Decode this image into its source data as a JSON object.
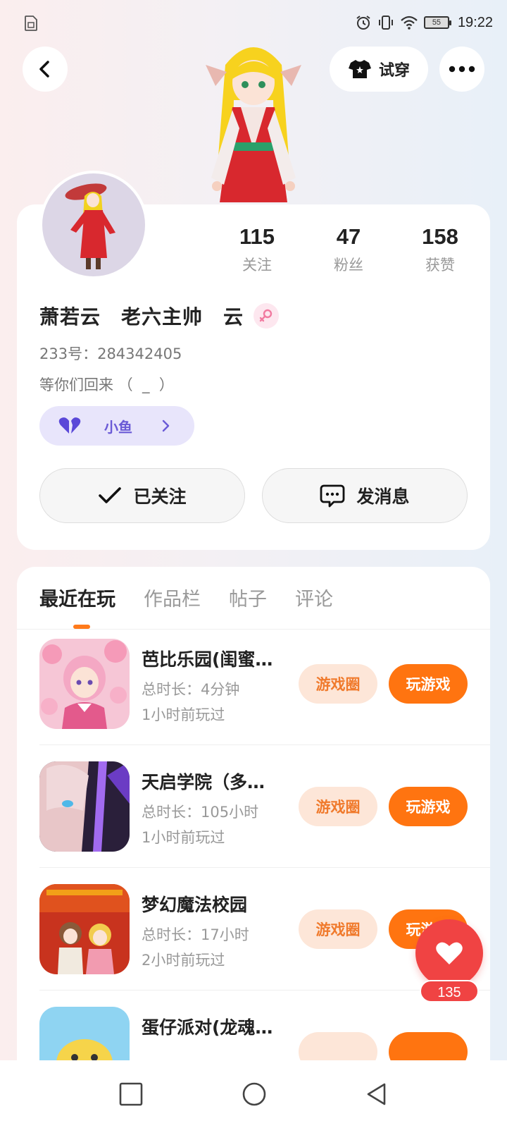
{
  "status_bar": {
    "time": "19:22",
    "battery": "55",
    "icons": [
      "sim-card-icon",
      "alarm-icon",
      "vibrate-icon",
      "wifi-icon",
      "battery-icon"
    ]
  },
  "header": {
    "tryon_label": "试穿",
    "back_icon": "chevron-left-icon",
    "more_icon": "more-dots-icon"
  },
  "profile": {
    "stats": [
      {
        "value": "115",
        "label": "关注"
      },
      {
        "value": "47",
        "label": "粉丝"
      },
      {
        "value": "158",
        "label": "获赞"
      }
    ],
    "name": "萧若云　老六主帅　云",
    "uid": "233号：284342405",
    "bio": "等你们回来 （  _  ）",
    "pet_tag": "小鱼",
    "follow_label": "已关注",
    "message_label": "发消息"
  },
  "tabs": [
    {
      "label": "最近在玩",
      "active": true
    },
    {
      "label": "作品栏",
      "active": false
    },
    {
      "label": "帖子",
      "active": false
    },
    {
      "label": "评论",
      "active": false
    }
  ],
  "games": [
    {
      "title": "芭比乐园(闺蜜…",
      "duration": "总时长：4分钟",
      "last_played": "1小时前玩过",
      "circle_label": "游戏圈",
      "play_label": "玩游戏"
    },
    {
      "title": "天启学院（多…",
      "duration": "总时长：105小时",
      "last_played": "1小时前玩过",
      "circle_label": "游戏圈",
      "play_label": "玩游戏"
    },
    {
      "title": "梦幻魔法校园",
      "duration": "总时长：17小时",
      "last_played": "2小时前玩过",
      "circle_label": "游戏圈",
      "play_label": "玩游戏"
    },
    {
      "title": "蛋仔派对(龙魂…",
      "duration": "",
      "last_played": "",
      "circle_label": "",
      "play_label": ""
    }
  ],
  "like": {
    "count": "135"
  },
  "colors": {
    "accent": "#ff7410",
    "like": "#f04343",
    "pet_tag_bg": "#e8e5fb"
  }
}
